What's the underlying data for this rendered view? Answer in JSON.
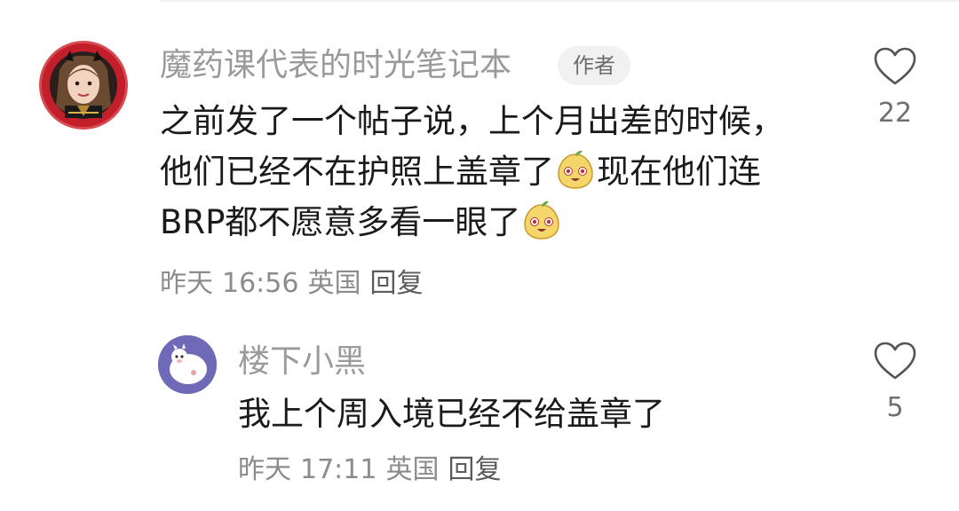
{
  "comment": {
    "author": "魔药课代表的时光笔记本",
    "badge": "作者",
    "lines": [
      [
        "之前发了一个帖子说，上个月出差的时候，"
      ],
      [
        "他们已经不在护照上盖章了",
        "现在他们连"
      ],
      [
        "BRP都不愿意多看一眼了"
      ]
    ],
    "emoji_icon": "pear-face-emoji",
    "meta": {
      "date": "昨天",
      "time": "16:56",
      "location": "英国",
      "reply": "回复"
    },
    "likes": "22"
  },
  "reply": {
    "author": "楼下小黑",
    "text": "我上个周入境已经不给盖章了",
    "meta": {
      "date": "昨天",
      "time": "17:11",
      "location": "英国",
      "reply": "回复"
    },
    "likes": "5"
  },
  "colors": {
    "text": "#1a1a1a",
    "muted": "#9a9a9a",
    "badge_bg": "#f1f1f1",
    "avatar_main_bg": "#c31f2b",
    "avatar_reply_bg": "#6f6ab8"
  }
}
